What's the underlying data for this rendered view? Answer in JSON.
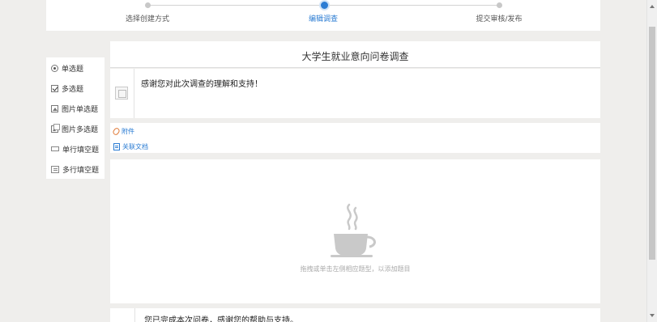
{
  "steps": [
    {
      "label": "选择创建方式",
      "active": false
    },
    {
      "label": "编辑调查",
      "active": true
    },
    {
      "label": "提交审核/发布",
      "active": false
    }
  ],
  "palette": {
    "items": [
      {
        "label": "单选题",
        "icon": "radio-icon"
      },
      {
        "label": "多选题",
        "icon": "checkbox-icon"
      },
      {
        "label": "图片单选题",
        "icon": "image-single-icon"
      },
      {
        "label": "图片多选题",
        "icon": "image-multi-icon"
      },
      {
        "label": "单行填空题",
        "icon": "single-line-icon"
      },
      {
        "label": "多行填空题",
        "icon": "multi-line-icon"
      }
    ]
  },
  "survey": {
    "title": "大学生就业意向问卷调查",
    "intro": "感谢您对此次调查的理解和支持！",
    "attachment_label": "附件",
    "linked_doc_label": "关联文档",
    "empty_hint": "拖拽或单击左侧相应题型，以添加题目",
    "end_text": "您已完成本次问卷，感谢您的帮助与支持。"
  },
  "colors": {
    "accent": "#2b7cd3",
    "attachment_icon": "#e07b39",
    "background": "#efeeec"
  }
}
